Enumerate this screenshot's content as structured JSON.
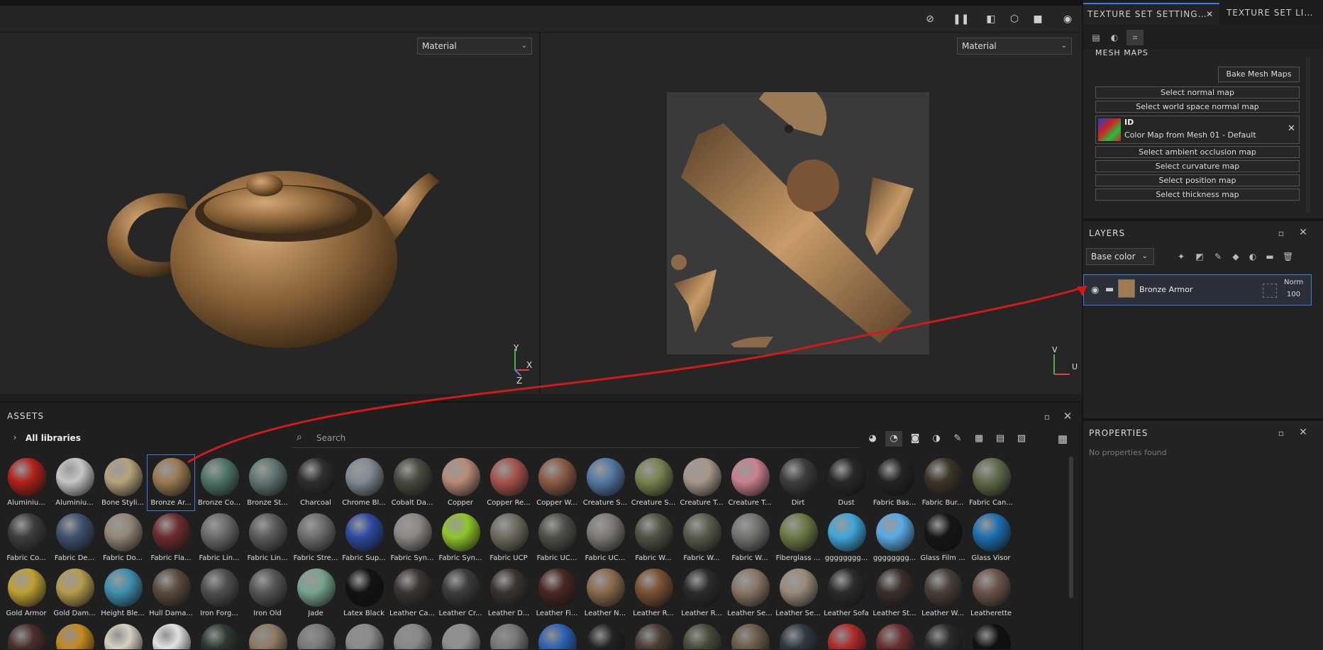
{
  "viewport": {
    "left_mode": "Material",
    "right_mode": "Material",
    "axis_3d": {
      "y": "Y",
      "x": "X",
      "z": "Z"
    },
    "axis_2d": {
      "v": "V",
      "u": "U"
    }
  },
  "assets": {
    "title": "ASSETS",
    "library": "All libraries",
    "search_placeholder": "Search",
    "materials": [
      {
        "label": "Aluminiu...",
        "color": "#b0221a"
      },
      {
        "label": "Aluminiu...",
        "color": "#c6c6c6"
      },
      {
        "label": "Bone Styli...",
        "color": "#b7a27c"
      },
      {
        "label": "Bronze Ar...",
        "color": "#9a7a52"
      },
      {
        "label": "Bronze Co...",
        "color": "#4d7565"
      },
      {
        "label": "Bronze St...",
        "color": "#5f7672"
      },
      {
        "label": "Charcoal",
        "color": "#2e2e2e"
      },
      {
        "label": "Chrome Bl...",
        "color": "#7f8a93"
      },
      {
        "label": "Cobalt Da...",
        "color": "#4a4a40"
      },
      {
        "label": "Copper",
        "color": "#b88a77"
      },
      {
        "label": "Copper Re...",
        "color": "#a6544a"
      },
      {
        "label": "Copper W...",
        "color": "#8a5a44"
      },
      {
        "label": "Creature S...",
        "color": "#5377a4"
      },
      {
        "label": "Creature S...",
        "color": "#76834f"
      },
      {
        "label": "Creature T...",
        "color": "#a8988a"
      },
      {
        "label": "Creature T...",
        "color": "#c9818d"
      },
      {
        "label": "Dirt",
        "color": "#3d3d3d"
      },
      {
        "label": "Dust",
        "color": "#282828"
      },
      {
        "label": "Fabric Bas...",
        "color": "#232323"
      },
      {
        "label": "Fabric Bur...",
        "color": "#3b3528"
      },
      {
        "label": "Fabric Can...",
        "color": "#606b4a"
      },
      {
        "label": "Fabric Co...",
        "color": "#3e3e3e"
      },
      {
        "label": "Fabric De...",
        "color": "#3e5170"
      },
      {
        "label": "Fabric Do...",
        "color": "#938676"
      },
      {
        "label": "Fabric Fla...",
        "color": "#6b2c2e"
      },
      {
        "label": "Fabric Lin...",
        "color": "#6b6b6b"
      },
      {
        "label": "Fabric Lin...",
        "color": "#5b5b5b"
      },
      {
        "label": "Fabric Stre...",
        "color": "#6d6d6d"
      },
      {
        "label": "Fabric Sup...",
        "color": "#2e4aa0"
      },
      {
        "label": "Fabric Syn...",
        "color": "#8c8783"
      },
      {
        "label": "Fabric Syn...",
        "color": "#8fc52b"
      },
      {
        "label": "Fabric UCP",
        "color": "#6e6c60"
      },
      {
        "label": "Fabric UC...",
        "color": "#505049"
      },
      {
        "label": "Fabric UC...",
        "color": "#7d7a74"
      },
      {
        "label": "Fabric W...",
        "color": "#4f5442"
      },
      {
        "label": "Fabric W...",
        "color": "#595c4b"
      },
      {
        "label": "Fabric W...",
        "color": "#737370"
      },
      {
        "label": "Fiberglass ...",
        "color": "#6b7a44"
      },
      {
        "label": "gggggggg...",
        "color": "#3fa6d8"
      },
      {
        "label": "gggggggg...",
        "color": "#5aa9e6"
      },
      {
        "label": "Glass Film ...",
        "color": "#151515"
      },
      {
        "label": "Glass Visor",
        "color": "#1d6fb0"
      },
      {
        "label": "Gold Armor",
        "color": "#bfa033"
      },
      {
        "label": "Gold Dam...",
        "color": "#b59b4e"
      },
      {
        "label": "Height Ble...",
        "color": "#3f8fb0"
      },
      {
        "label": "Hull Dama...",
        "color": "#5b4a3d"
      },
      {
        "label": "Iron Forg...",
        "color": "#4f4f4f"
      },
      {
        "label": "Iron Old",
        "color": "#575555"
      },
      {
        "label": "Jade",
        "color": "#77a48d"
      },
      {
        "label": "Latex Black",
        "color": "#121212"
      },
      {
        "label": "Leather Ca...",
        "color": "#3b3532"
      },
      {
        "label": "Leather Cr...",
        "color": "#3d3c3b"
      },
      {
        "label": "Leather D...",
        "color": "#3a3430"
      },
      {
        "label": "Leather Fi...",
        "color": "#4a2722"
      },
      {
        "label": "Leather N...",
        "color": "#8a6a4a"
      },
      {
        "label": "Leather R...",
        "color": "#7a5030"
      },
      {
        "label": "Leather R...",
        "color": "#2c2c2c"
      },
      {
        "label": "Leather Se...",
        "color": "#8a7666"
      },
      {
        "label": "Leather Se...",
        "color": "#9a8a7a"
      },
      {
        "label": "Leather Sofa",
        "color": "#2b2b2b"
      },
      {
        "label": "Leather St...",
        "color": "#3a302b"
      },
      {
        "label": "Leather W...",
        "color": "#4a3f38"
      },
      {
        "label": "Leatherette",
        "color": "#6b5348"
      }
    ],
    "partial_row_colors": [
      "#4a2f2a",
      "#c48a1f",
      "#d8d0c2",
      "#e2e2e2",
      "#2c3a30",
      "#8f7a62",
      "#7a7a7a",
      "#8a8a8a",
      "#888",
      "#8f8f8f",
      "#777",
      "#2d62b3",
      "#222",
      "#4a3c33",
      "#4a4a3a",
      "#6b5a48",
      "#2d3a40",
      "#b02a2a",
      "#6a2f2f",
      "#2a2a2a",
      "#111"
    ]
  },
  "texture_set": {
    "tab_active": "TEXTURE SET SETTING…",
    "tab_other": "TEXTURE SET LI…",
    "section": "MESH MAPS",
    "bake_button": "Bake Mesh Maps",
    "maps": [
      "Select normal map",
      "Select world space normal map"
    ],
    "id_map": {
      "title": "ID",
      "value": "Color Map from Mesh 01 - Default"
    },
    "maps_after": [
      "Select ambient occlusion map",
      "Select curvature map",
      "Select position map",
      "Select thickness map"
    ]
  },
  "layers": {
    "title": "LAYERS",
    "channel": "Base color",
    "layer": {
      "name": "Bronze Armor",
      "blend": "Norm",
      "opacity": "100",
      "color": "#a07a50"
    }
  },
  "properties": {
    "title": "PROPERTIES",
    "empty": "No properties found"
  },
  "colors": {
    "accent": "#3f7be0",
    "annotation": "#d11a1a"
  }
}
